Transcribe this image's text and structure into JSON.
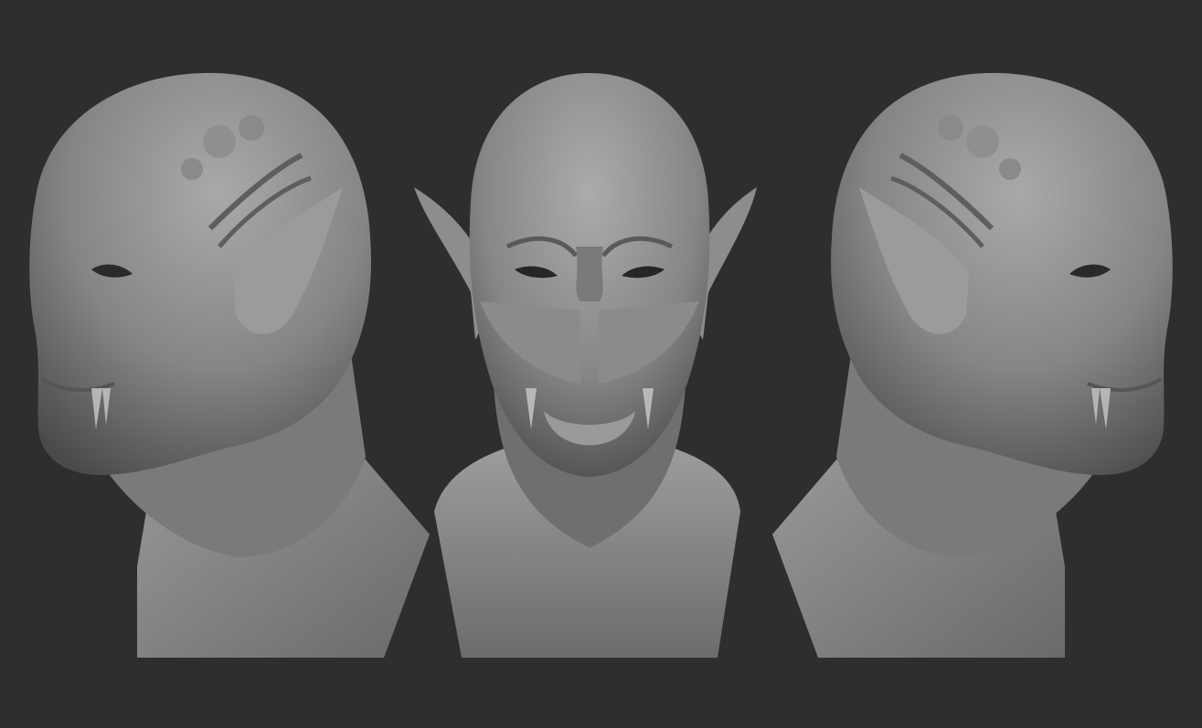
{
  "scene": {
    "background_color": "#2e2e2e",
    "material_color": "#8c8c8c",
    "views": [
      {
        "id": "left",
        "description_icon": "bust-three-quarter-left-icon"
      },
      {
        "id": "front",
        "description_icon": "bust-front-icon"
      },
      {
        "id": "right",
        "description_icon": "bust-three-quarter-right-icon"
      }
    ]
  }
}
